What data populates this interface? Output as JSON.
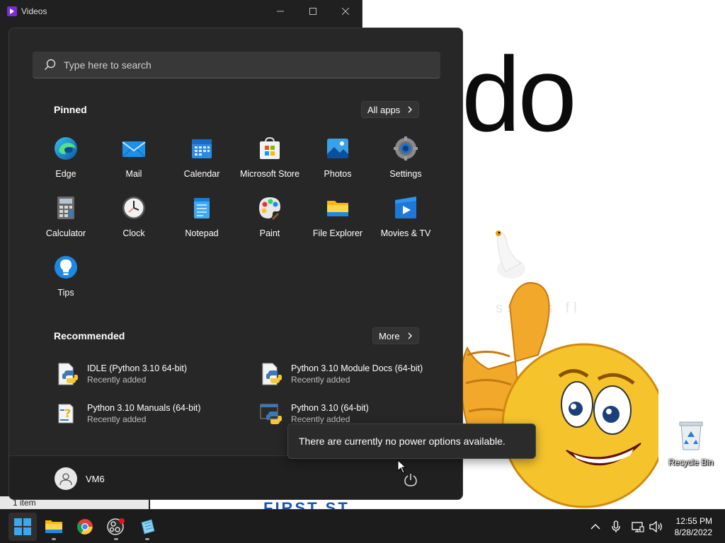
{
  "background_window": {
    "title": "Videos",
    "status_text": "1 item",
    "banner_text": "FIRST ST"
  },
  "desktop": {
    "wallpaper_text": "do",
    "faint_text": "ss sfs fl",
    "recycle_bin_label": "Recycle Bin"
  },
  "start_menu": {
    "search_placeholder": "Type here to search",
    "pinned_title": "Pinned",
    "all_apps_label": "All apps",
    "pinned_apps": [
      {
        "label": "Edge",
        "icon": "edge-icon"
      },
      {
        "label": "Mail",
        "icon": "mail-icon"
      },
      {
        "label": "Calendar",
        "icon": "calendar-icon"
      },
      {
        "label": "Microsoft Store",
        "icon": "store-icon"
      },
      {
        "label": "Photos",
        "icon": "photos-icon"
      },
      {
        "label": "Settings",
        "icon": "settings-icon"
      },
      {
        "label": "Calculator",
        "icon": "calculator-icon"
      },
      {
        "label": "Clock",
        "icon": "clock-icon"
      },
      {
        "label": "Notepad",
        "icon": "notepad-icon"
      },
      {
        "label": "Paint",
        "icon": "paint-icon"
      },
      {
        "label": "File Explorer",
        "icon": "folder-icon"
      },
      {
        "label": "Movies & TV",
        "icon": "movies-icon"
      },
      {
        "label": "Tips",
        "icon": "tips-icon"
      }
    ],
    "recommended_title": "Recommended",
    "more_label": "More",
    "recommended": [
      {
        "title": "IDLE (Python 3.10 64-bit)",
        "subtitle": "Recently added",
        "icon": "python-idle-icon"
      },
      {
        "title": "Python 3.10 Module Docs (64-bit)",
        "subtitle": "Recently added",
        "icon": "python-docs-icon"
      },
      {
        "title": "Python 3.10 Manuals (64-bit)",
        "subtitle": "Recently added",
        "icon": "python-manuals-icon"
      },
      {
        "title": "Python 3.10 (64-bit)",
        "subtitle": "Recently added",
        "icon": "python-icon"
      }
    ],
    "user_name": "VM6",
    "power_tooltip": "There are currently no power options available."
  },
  "taskbar": {
    "apps": [
      "start-icon",
      "file-explorer-icon",
      "chrome-icon",
      "obs-icon",
      "notepad-icon"
    ],
    "time": "12:55 PM",
    "date": "8/28/2022"
  },
  "colors": {
    "start_bg": "#272727",
    "accent": "#0078d4",
    "taskbar_bg": "#1c1c1c"
  }
}
